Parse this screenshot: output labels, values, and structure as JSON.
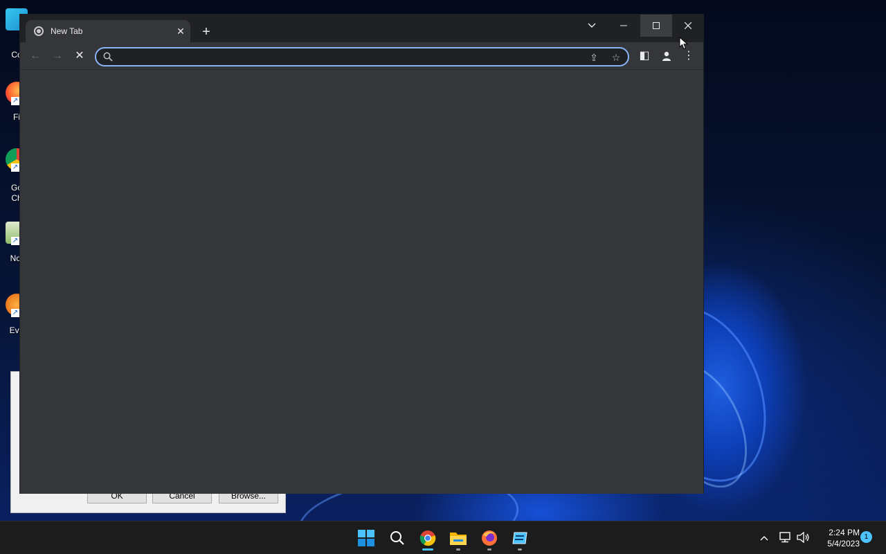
{
  "desktop": {
    "icons": [
      {
        "label": "Co",
        "icon": "computer-icon"
      },
      {
        "label": "Fi",
        "icon": "firefox-icon"
      },
      {
        "label": "Go",
        "label2": "Ch",
        "icon": "chrome-icon"
      },
      {
        "label": "Not",
        "icon": "notepad-icon"
      },
      {
        "label": "Eve",
        "icon": "app-icon"
      }
    ],
    "background_dialog": {
      "buttons": [
        "OK",
        "Cancel",
        "Browse..."
      ]
    }
  },
  "browser": {
    "tab": {
      "title": "New Tab",
      "close_glyph": "✕",
      "favicon": "loading-icon"
    },
    "new_tab_glyph": "+",
    "window_controls": {
      "tab_search": "⌄",
      "minimize": "—",
      "maximize": "☐",
      "close": "✕"
    },
    "toolbar": {
      "back": "←",
      "forward": "→",
      "stop": "✕",
      "omnibox": {
        "value": "",
        "placeholder": ""
      },
      "share": "⇪",
      "bookmark": "☆",
      "side_panel": "◧",
      "profile": "●",
      "menu": "⋮"
    }
  },
  "taskbar": {
    "apps": [
      "start-icon",
      "search-icon",
      "chrome-icon",
      "file-explorer-icon",
      "firefox-icon",
      "app-icon"
    ],
    "tray": {
      "chevron": "⌃"
    },
    "clock": {
      "time": "2:24 PM",
      "date": "5/4/2023"
    },
    "notification_count": "1"
  },
  "colors": {
    "accent": "#8ab4f8",
    "chrome_dark": "#202124",
    "chrome_surface": "#35363a",
    "taskbar": "#1c1c1c",
    "taskbar_active": "#4cc2ff"
  }
}
